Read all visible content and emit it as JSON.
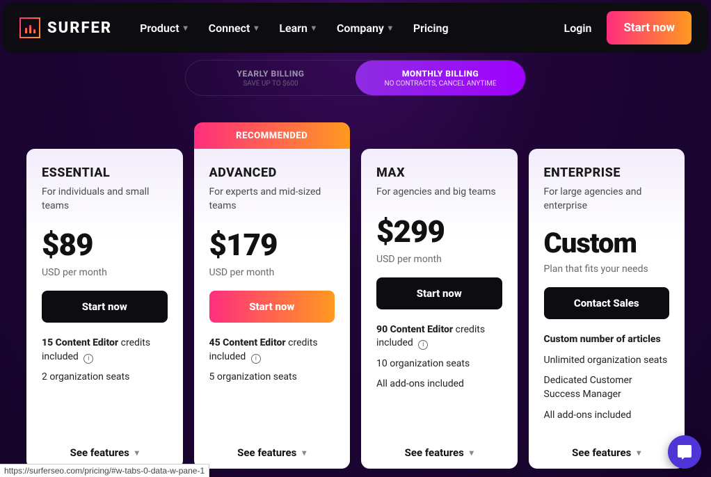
{
  "nav": {
    "brand": "SURFER",
    "links": [
      "Product",
      "Connect",
      "Learn",
      "Company",
      "Pricing"
    ],
    "login": "Login",
    "cta": "Start now"
  },
  "billing": {
    "yearly": {
      "title": "YEARLY BILLING",
      "sub": "SAVE UP TO $600"
    },
    "monthly": {
      "title": "MONTHLY BILLING",
      "sub": "NO CONTRACTS, CANCEL ANYTIME"
    },
    "active": "monthly"
  },
  "ribbon": "RECOMMENDED",
  "plans": [
    {
      "name": "ESSENTIAL",
      "desc": "For individuals and small teams",
      "price": "$89",
      "price_sub": "USD per month",
      "button": "Start now",
      "accent": false,
      "credits_bold": "15 Content Editor",
      "credits_rest": " credits included",
      "info": true,
      "lines": [
        "2 organization seats"
      ]
    },
    {
      "name": "ADVANCED",
      "desc": "For experts and mid-sized teams",
      "price": "$179",
      "price_sub": "USD per month",
      "button": "Start now",
      "accent": true,
      "ribbon": true,
      "credits_bold": "45 Content Editor",
      "credits_rest": " credits included",
      "info": true,
      "lines": [
        "5 organization seats"
      ]
    },
    {
      "name": "MAX",
      "desc": "For agencies and big teams",
      "price": "$299",
      "price_sub": "USD per month",
      "button": "Start now",
      "accent": false,
      "credits_bold": "90 Content Editor",
      "credits_rest": " credits included",
      "info": true,
      "lines": [
        "10 organization seats",
        "All add-ons included"
      ]
    },
    {
      "name": "ENTERPRISE",
      "desc": "For large agencies and enterprise",
      "price": "Custom",
      "price_sub": "Plan that fits your needs",
      "button": "Contact Sales",
      "accent": false,
      "credits_bold": "Custom number of articles",
      "credits_rest": "",
      "info": false,
      "lines": [
        "Unlimited organization seats",
        "Dedicated Customer Success Manager",
        "All add-ons included"
      ]
    }
  ],
  "see_features": "See features",
  "status_url": "https://surferseo.com/pricing/#w-tabs-0-data-w-pane-1"
}
